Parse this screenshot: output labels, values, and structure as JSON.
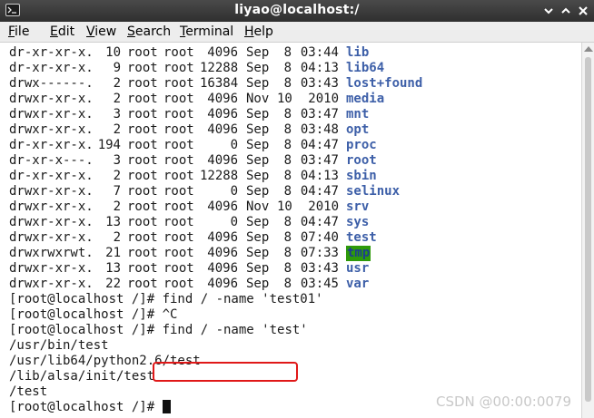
{
  "window": {
    "title": "liyao@localhost:/",
    "icon": "terminal-icon"
  },
  "menu": [
    "File",
    "Edit",
    "View",
    "Search",
    "Terminal",
    "Help"
  ],
  "listing": [
    {
      "perm": "dr-xr-xr-x.",
      "links": "10",
      "user": "root",
      "group": "root",
      "size": "4096",
      "month": "Sep",
      "day": "8",
      "time": "03:44",
      "name": "lib"
    },
    {
      "perm": "dr-xr-xr-x.",
      "links": "9",
      "user": "root",
      "group": "root",
      "size": "12288",
      "month": "Sep",
      "day": "8",
      "time": "04:13",
      "name": "lib64"
    },
    {
      "perm": "drwx------.",
      "links": "2",
      "user": "root",
      "group": "root",
      "size": "16384",
      "month": "Sep",
      "day": "8",
      "time": "03:43",
      "name": "lost+found"
    },
    {
      "perm": "drwxr-xr-x.",
      "links": "2",
      "user": "root",
      "group": "root",
      "size": "4096",
      "month": "Nov",
      "day": "10",
      "time": "2010",
      "name": "media"
    },
    {
      "perm": "drwxr-xr-x.",
      "links": "3",
      "user": "root",
      "group": "root",
      "size": "4096",
      "month": "Sep",
      "day": "8",
      "time": "03:47",
      "name": "mnt"
    },
    {
      "perm": "drwxr-xr-x.",
      "links": "2",
      "user": "root",
      "group": "root",
      "size": "4096",
      "month": "Sep",
      "day": "8",
      "time": "03:48",
      "name": "opt"
    },
    {
      "perm": "dr-xr-xr-x.",
      "links": "194",
      "user": "root",
      "group": "root",
      "size": "0",
      "month": "Sep",
      "day": "8",
      "time": "04:47",
      "name": "proc"
    },
    {
      "perm": "dr-xr-x---.",
      "links": "3",
      "user": "root",
      "group": "root",
      "size": "4096",
      "month": "Sep",
      "day": "8",
      "time": "03:47",
      "name": "root"
    },
    {
      "perm": "dr-xr-xr-x.",
      "links": "2",
      "user": "root",
      "group": "root",
      "size": "12288",
      "month": "Sep",
      "day": "8",
      "time": "04:13",
      "name": "sbin"
    },
    {
      "perm": "drwxr-xr-x.",
      "links": "7",
      "user": "root",
      "group": "root",
      "size": "0",
      "month": "Sep",
      "day": "8",
      "time": "04:47",
      "name": "selinux"
    },
    {
      "perm": "drwxr-xr-x.",
      "links": "2",
      "user": "root",
      "group": "root",
      "size": "4096",
      "month": "Nov",
      "day": "10",
      "time": "2010",
      "name": "srv"
    },
    {
      "perm": "drwxr-xr-x.",
      "links": "13",
      "user": "root",
      "group": "root",
      "size": "0",
      "month": "Sep",
      "day": "8",
      "time": "04:47",
      "name": "sys"
    },
    {
      "perm": "drwxr-xr-x.",
      "links": "2",
      "user": "root",
      "group": "root",
      "size": "4096",
      "month": "Sep",
      "day": "8",
      "time": "07:40",
      "name": "test"
    },
    {
      "perm": "drwxrwxrwt.",
      "links": "21",
      "user": "root",
      "group": "root",
      "size": "4096",
      "month": "Sep",
      "day": "8",
      "time": "07:33",
      "name": "tmp",
      "highlight": true
    },
    {
      "perm": "drwxr-xr-x.",
      "links": "13",
      "user": "root",
      "group": "root",
      "size": "4096",
      "month": "Sep",
      "day": "8",
      "time": "03:43",
      "name": "usr"
    },
    {
      "perm": "drwxr-xr-x.",
      "links": "22",
      "user": "root",
      "group": "root",
      "size": "4096",
      "month": "Sep",
      "day": "8",
      "time": "03:45",
      "name": "var"
    }
  ],
  "session": {
    "prompt": "[root@localhost /]# ",
    "cmd1": "find / -name 'test01'",
    "cmd2": "^C",
    "cmd3": "find / -name 'test'",
    "results": [
      "/usr/bin/test",
      "/usr/lib64/python2.6/test",
      "/lib/alsa/init/test",
      "/test"
    ]
  },
  "watermark": "CSDN @00:00:0079",
  "colors": {
    "dir_name": "#3d5fa8",
    "sticky_dir_background": "#2e9a0a",
    "annotation_box": "#e01818"
  }
}
